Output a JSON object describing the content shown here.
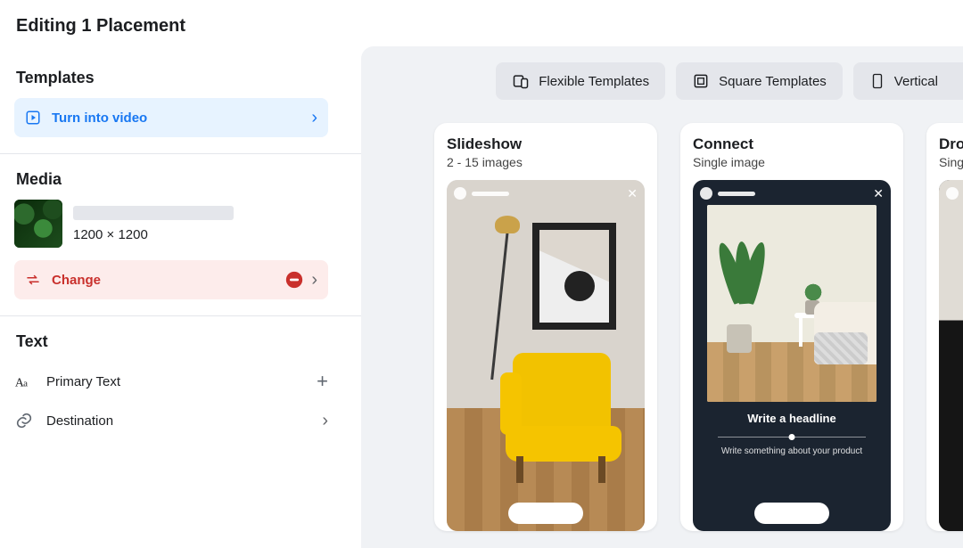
{
  "page_title": "Editing 1 Placement",
  "sections": {
    "templates": {
      "heading": "Templates",
      "turn_into_video": "Turn into video"
    },
    "media": {
      "heading": "Media",
      "dimensions": "1200 × 1200",
      "change": "Change"
    },
    "text": {
      "heading": "Text",
      "primary_text": "Primary Text",
      "destination": "Destination"
    }
  },
  "toolbar": {
    "flexible": "Flexible Templates",
    "square": "Square Templates",
    "vertical": "Vertical "
  },
  "cards": [
    {
      "title": "Slideshow",
      "subtitle": "2 - 15 images"
    },
    {
      "title": "Connect",
      "subtitle": "Single image",
      "headline": "Write a headline",
      "subline": "Write something about your product"
    },
    {
      "title": "Drop",
      "subtitle": "Singl"
    }
  ]
}
